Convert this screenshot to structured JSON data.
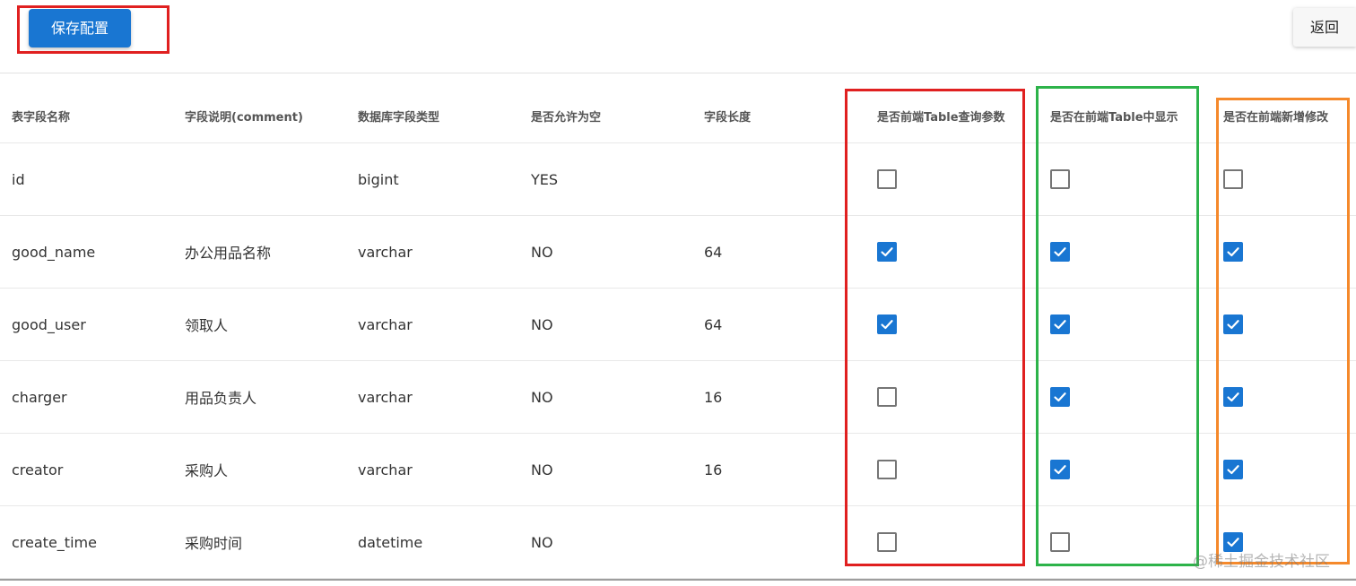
{
  "toolbar": {
    "save_label": "保存配置",
    "back_label": "返回"
  },
  "table": {
    "columns": [
      "表字段名称",
      "字段说明(comment)",
      "数据库字段类型",
      "是否允许为空",
      "字段长度",
      "是否前端Table查询参数",
      "是否在前端Table中显示",
      "是否在前端新增修改"
    ],
    "rows": [
      {
        "name": "id",
        "comment": "",
        "type": "bigint",
        "nullable": "YES",
        "length": "",
        "query_param": false,
        "show_in_table": false,
        "add_edit": false
      },
      {
        "name": "good_name",
        "comment": "办公用品名称",
        "type": "varchar",
        "nullable": "NO",
        "length": "64",
        "query_param": true,
        "show_in_table": true,
        "add_edit": true
      },
      {
        "name": "good_user",
        "comment": "领取人",
        "type": "varchar",
        "nullable": "NO",
        "length": "64",
        "query_param": true,
        "show_in_table": true,
        "add_edit": true
      },
      {
        "name": "charger",
        "comment": "用品负责人",
        "type": "varchar",
        "nullable": "NO",
        "length": "16",
        "query_param": false,
        "show_in_table": true,
        "add_edit": true
      },
      {
        "name": "creator",
        "comment": "采购人",
        "type": "varchar",
        "nullable": "NO",
        "length": "16",
        "query_param": false,
        "show_in_table": true,
        "add_edit": true
      },
      {
        "name": "create_time",
        "comment": "采购时间",
        "type": "datetime",
        "nullable": "NO",
        "length": "",
        "query_param": false,
        "show_in_table": false,
        "add_edit": true
      }
    ]
  },
  "watermark": "@稀土掘金技术社区",
  "colors": {
    "primary": "#1976d2",
    "highlight_red": "#e02020",
    "highlight_green": "#2db34a",
    "highlight_orange": "#f5892b"
  }
}
